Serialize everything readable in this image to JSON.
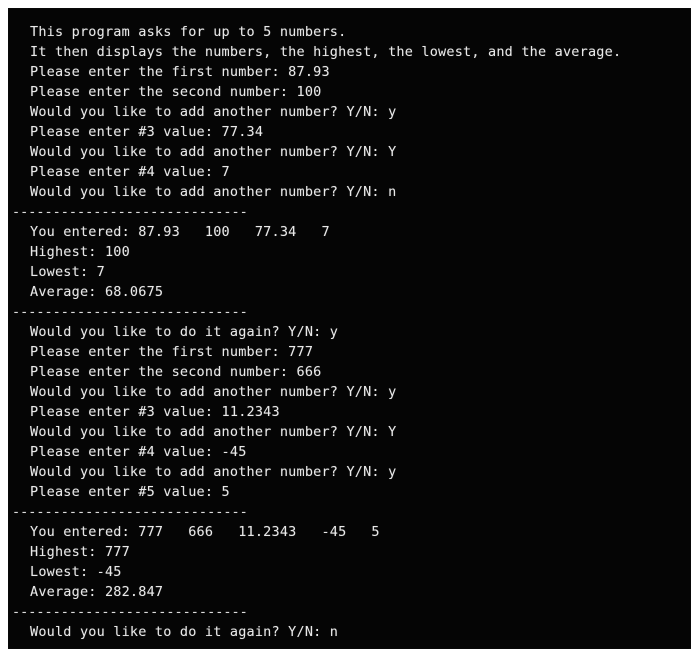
{
  "console": {
    "background_color": "#050505",
    "text_color": "#e9e9e9",
    "page_background_color": "#ffffff",
    "separator": "- - - - - - - - - - - - - - -",
    "lines": [
      {
        "id": "intro-1",
        "text": "This program asks for up to 5 numbers."
      },
      {
        "id": "intro-2",
        "text": "It then displays the numbers, the highest, the lowest, and the average."
      },
      {
        "id": "run1-prompt-1",
        "text": "Please enter the first number: 87.93"
      },
      {
        "id": "run1-prompt-2",
        "text": "Please enter the second number: 100"
      },
      {
        "id": "run1-another-1",
        "text": "Would you like to add another number? Y/N: y"
      },
      {
        "id": "run1-prompt-3",
        "text": "Please enter #3 value: 77.34"
      },
      {
        "id": "run1-another-2",
        "text": "Would you like to add another number? Y/N: Y"
      },
      {
        "id": "run1-prompt-4",
        "text": "Please enter #4 value: 7"
      },
      {
        "id": "run1-another-3",
        "text": "Would you like to add another number? Y/N: n"
      },
      {
        "id": "separator-1",
        "text": "-----------------------------",
        "type": "separator"
      },
      {
        "id": "run1-entered",
        "text": "You entered: 87.93   100   77.34   7"
      },
      {
        "id": "run1-highest",
        "text": "Highest: 100"
      },
      {
        "id": "run1-lowest",
        "text": "Lowest: 7"
      },
      {
        "id": "run1-average",
        "text": "Average: 68.0675"
      },
      {
        "id": "separator-2",
        "text": "-----------------------------",
        "type": "separator"
      },
      {
        "id": "again-1",
        "text": "Would you like to do it again? Y/N: y"
      },
      {
        "id": "run2-prompt-1",
        "text": "Please enter the first number: 777"
      },
      {
        "id": "run2-prompt-2",
        "text": "Please enter the second number: 666"
      },
      {
        "id": "run2-another-1",
        "text": "Would you like to add another number? Y/N: y"
      },
      {
        "id": "run2-prompt-3",
        "text": "Please enter #3 value: 11.2343"
      },
      {
        "id": "run2-another-2",
        "text": "Would you like to add another number? Y/N: Y"
      },
      {
        "id": "run2-prompt-4",
        "text": "Please enter #4 value: -45"
      },
      {
        "id": "run2-another-3",
        "text": "Would you like to add another number? Y/N: y"
      },
      {
        "id": "run2-prompt-5",
        "text": "Please enter #5 value: 5"
      },
      {
        "id": "separator-3",
        "text": "-----------------------------",
        "type": "separator"
      },
      {
        "id": "run2-entered",
        "text": "You entered: 777   666   11.2343   -45   5"
      },
      {
        "id": "run2-highest",
        "text": "Highest: 777"
      },
      {
        "id": "run2-lowest",
        "text": "Lowest: -45"
      },
      {
        "id": "run2-average",
        "text": "Average: 282.847"
      },
      {
        "id": "separator-4",
        "text": "-----------------------------",
        "type": "separator"
      },
      {
        "id": "again-2",
        "text": "Would you like to do it again? Y/N: n"
      }
    ]
  },
  "program": {
    "max_numbers": 5,
    "runs": [
      {
        "entered": [
          "87.93",
          "100",
          "77.34",
          "7"
        ],
        "highest": "100",
        "lowest": "7",
        "average": "68.0675",
        "repeat_answer": "y"
      },
      {
        "entered": [
          "777",
          "666",
          "11.2343",
          "-45",
          "5"
        ],
        "highest": "777",
        "lowest": "-45",
        "average": "282.847",
        "repeat_answer": "n"
      }
    ]
  }
}
